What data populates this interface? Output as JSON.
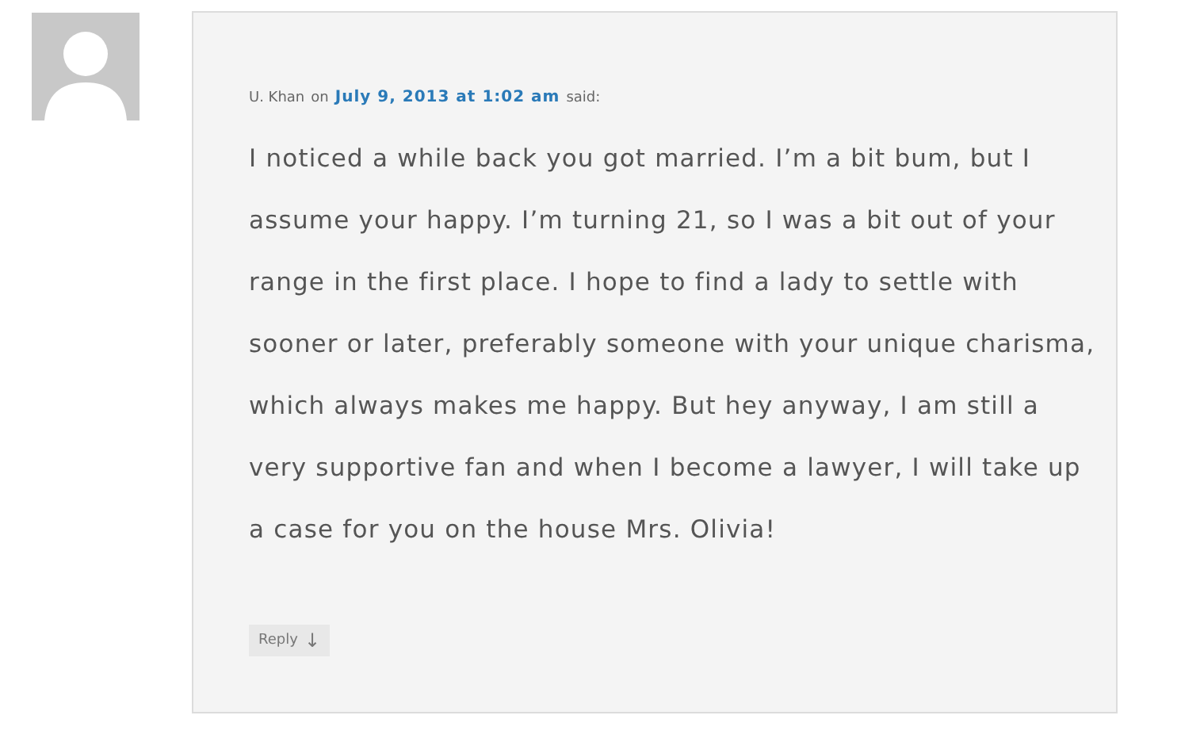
{
  "comment": {
    "author": "U. Khan",
    "on": "on",
    "date": "July 9, 2013 at 1:02 am",
    "said": "said:",
    "body": "I noticed a while back you got married. I’m a bit bum, but I assume your happy. I’m turning 21, so I was a bit out of your range in the first place. I hope to find a lady to settle with sooner or later, preferably someone with your unique charisma, which always makes me happy. But hey anyway, I am still a very supportive fan and when I become a lawyer, I will take up a case for you on the house Mrs. Olivia!",
    "reply": {
      "label": "Reply",
      "arrow": "↓"
    }
  }
}
